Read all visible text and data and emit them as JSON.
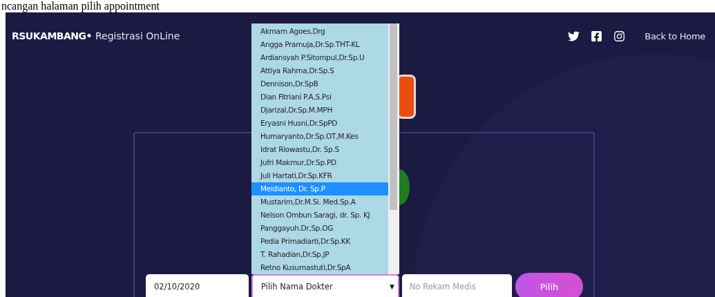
{
  "caption": "ncangan halaman pilih appointment",
  "header": {
    "brand": "RSUKAMBANG•",
    "subtitle": "Registrasi OnLine",
    "back_link": "Back to Home"
  },
  "form": {
    "date": "02/10/2020",
    "doctor_select": {
      "placeholder": "Pilih Nama Dokter",
      "caret": "▼",
      "expanded": true,
      "options": [
        {
          "label": "Akmam Agoes,Drg",
          "selected": false
        },
        {
          "label": "Angga Pramuja,Dr.Sp.THT-KL",
          "selected": false
        },
        {
          "label": "Ardiansyah P.Sitompul,Dr.Sp.U",
          "selected": false
        },
        {
          "label": "Attiya Rahma,Dr.Sp.S",
          "selected": false
        },
        {
          "label": "Dennison,Dr.SpB",
          "selected": false
        },
        {
          "label": "Dian Fitriani P.A,S.Psi",
          "selected": false
        },
        {
          "label": "Djarizal,Dr.Sp.M.MPH",
          "selected": false
        },
        {
          "label": "Eryasni Husni,Dr.SpPD",
          "selected": false
        },
        {
          "label": "Humaryanto,Dr.Sp.OT,M.Kes",
          "selected": false
        },
        {
          "label": "Idrat Riowastu,Dr. Sp.S",
          "selected": false
        },
        {
          "label": "Jufri Makmur,Dr.Sp.PD",
          "selected": false
        },
        {
          "label": "Juli Hartati,Dr.Sp.KFR",
          "selected": false
        },
        {
          "label": "Meidianto, Dr. Sp.P",
          "selected": true
        },
        {
          "label": "Mustarim,Dr.M.Si. Med.Sp.A",
          "selected": false
        },
        {
          "label": "Nelson Ombun Saragi, dr. Sp. KJ",
          "selected": false
        },
        {
          "label": "Panggayuh.Dr,Sp.OG",
          "selected": false
        },
        {
          "label": "Pedia Primadiarti,Dr.Sp.KK",
          "selected": false
        },
        {
          "label": "T. Rahadian,Dr.Sp.JP",
          "selected": false
        },
        {
          "label": "Retno Kusumastuti,Dr.SpA",
          "selected": false
        }
      ]
    },
    "record_field": {
      "placeholder": "No Rekam Medis"
    },
    "submit": "Pilih"
  }
}
